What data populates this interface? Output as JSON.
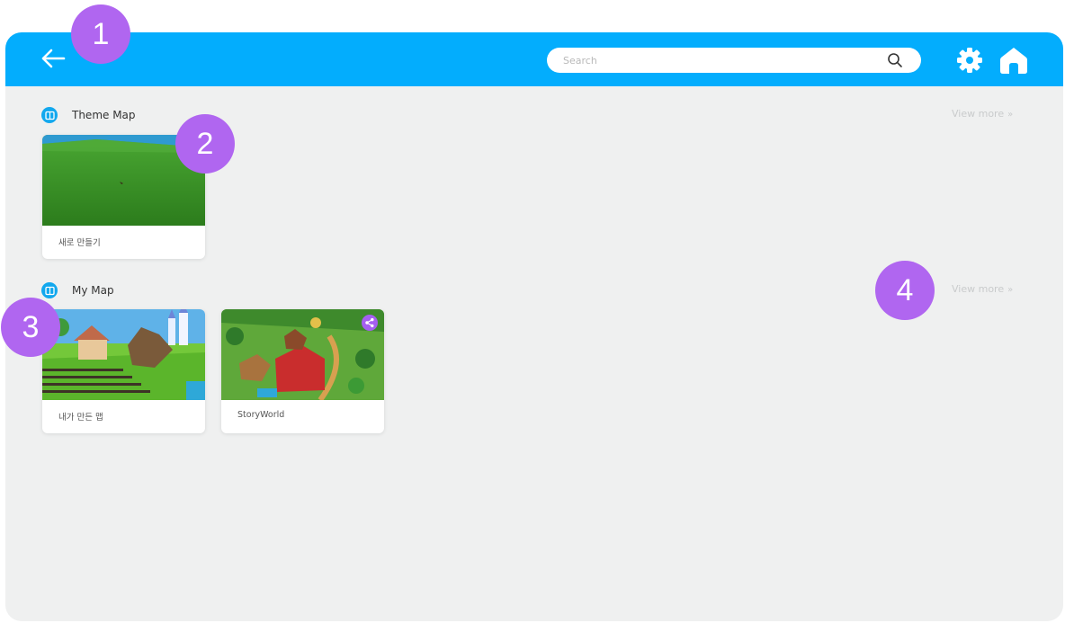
{
  "header": {
    "search_placeholder": "Search"
  },
  "sections": [
    {
      "title": "Theme Map",
      "view_more": "View more",
      "cards": [
        {
          "label": "새로 만들기"
        }
      ]
    },
    {
      "title": "My Map",
      "view_more": "View more",
      "cards": [
        {
          "label": "내가 만든 맵"
        },
        {
          "label": "StoryWorld",
          "shared": true
        }
      ]
    }
  ],
  "annotations": [
    "1",
    "2",
    "3",
    "4"
  ],
  "colors": {
    "header": "#03adfd",
    "background": "#eff0f0",
    "badge": "#b066f0"
  },
  "icons": [
    "back-arrow-icon",
    "search-icon",
    "settings-gear-icon",
    "home-icon",
    "map-book-icon",
    "share-icon"
  ]
}
